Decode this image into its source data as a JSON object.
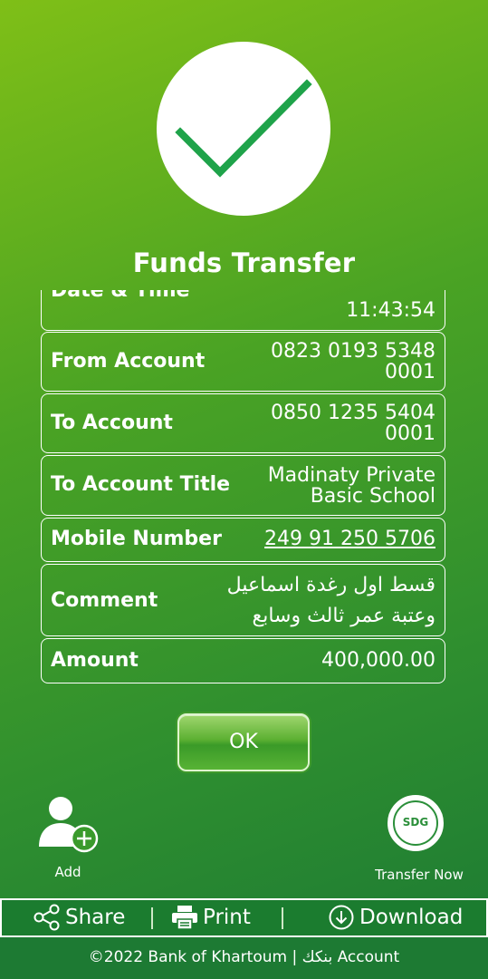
{
  "header": {
    "title": "Funds Transfer"
  },
  "details": [
    {
      "label": "Date & Time",
      "value": "11:43:54"
    },
    {
      "label": "From Account",
      "value_line1": "0823 0193 5348",
      "value_line2": "0001"
    },
    {
      "label": "To Account",
      "value_line1": "0850 1235 5404",
      "value_line2": "0001"
    },
    {
      "label": "To Account Title",
      "value_line1": "Madinaty Private",
      "value_line2": "Basic School"
    },
    {
      "label": "Mobile Number",
      "value": "249 91 250 5706"
    },
    {
      "label": "Comment",
      "value_line1": "قسط اول رغدة اسماعيل",
      "value_line2": "وعتبة عمر ثالث وسابع"
    },
    {
      "label": "Amount",
      "value": "400,000.00"
    }
  ],
  "ok_button": {
    "label": "OK"
  },
  "quick_actions": {
    "add_label": "Add",
    "transfer_now_label": "Transfer Now",
    "badge_text": "SDG"
  },
  "action_bar": {
    "share": "Share",
    "print": "Print",
    "download": "Download"
  },
  "footer": {
    "text": "©2022 Bank of Khartoum | بنكك Account"
  },
  "colors": {
    "accent_green": "#2b8f3a",
    "check_green": "#1fa34a"
  }
}
